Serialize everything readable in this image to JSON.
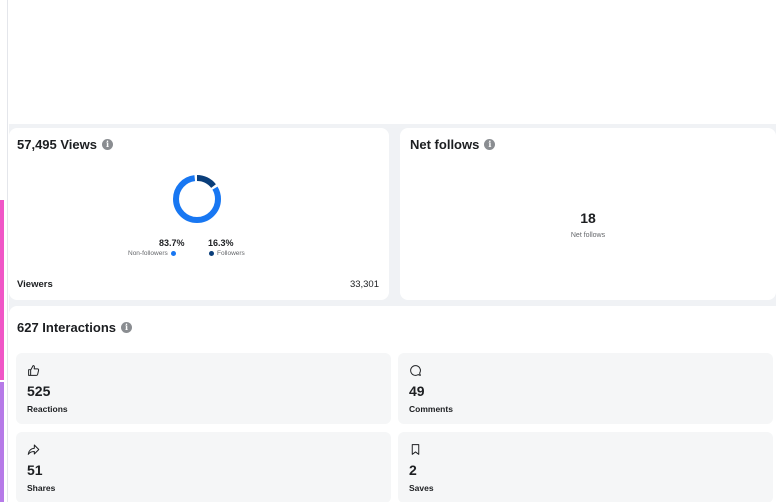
{
  "views_card": {
    "title": "57,495 Views",
    "non_followers_pct": "83.7%",
    "followers_pct": "16.3%",
    "non_followers_share": 0.837,
    "followers_share": 0.163,
    "non_followers_label": "Non-followers",
    "followers_label": "Followers",
    "viewers_label": "Viewers",
    "viewers_value": "33,301"
  },
  "follows_card": {
    "title": "Net follows",
    "value": "18",
    "caption": "Net follows"
  },
  "interactions_card": {
    "title": "627 Interactions",
    "metrics": [
      {
        "icon": "thumbs-up-icon",
        "value": "525",
        "label": "Reactions"
      },
      {
        "icon": "comment-icon",
        "value": "49",
        "label": "Comments"
      },
      {
        "icon": "share-icon",
        "value": "51",
        "label": "Shares"
      },
      {
        "icon": "bookmark-icon",
        "value": "2",
        "label": "Saves"
      }
    ]
  },
  "colors": {
    "non_followers": "#1877f2",
    "followers": "#0a3e7a",
    "accent_pink": "#f056c7",
    "accent_purple": "#b67ae8"
  }
}
